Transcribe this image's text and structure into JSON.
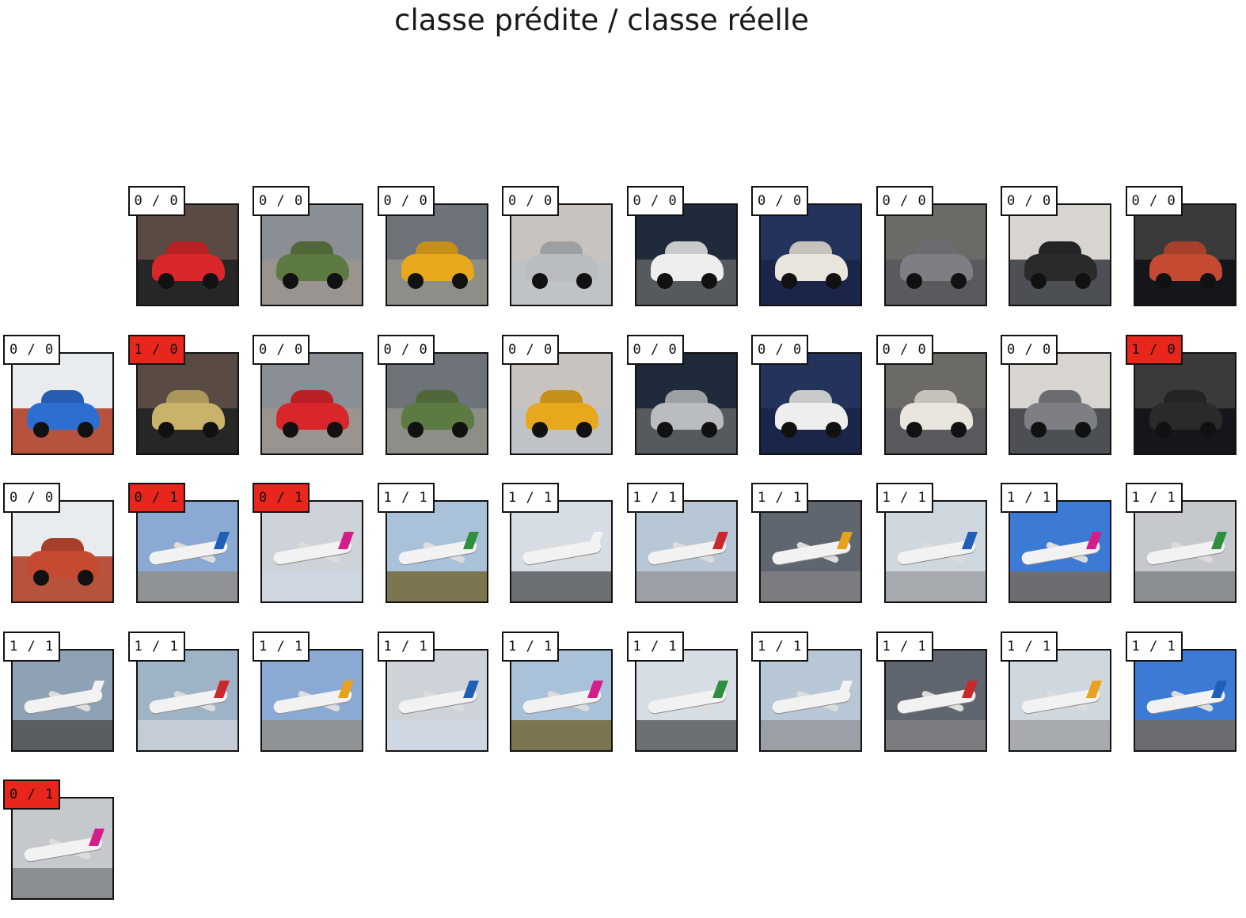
{
  "title": "classe prédite / classe réelle",
  "colors": {
    "misclassified": "#e8261c",
    "correct": "#ffffff"
  },
  "rows": [
    {
      "start_col": 1,
      "cells": [
        {
          "label": "0 / 0",
          "wrong": false,
          "kind": "car"
        },
        {
          "label": "0 / 0",
          "wrong": false,
          "kind": "car"
        },
        {
          "label": "0 / 0",
          "wrong": false,
          "kind": "car"
        },
        {
          "label": "0 / 0",
          "wrong": false,
          "kind": "car"
        },
        {
          "label": "0 / 0",
          "wrong": false,
          "kind": "car"
        },
        {
          "label": "0 / 0",
          "wrong": false,
          "kind": "car"
        },
        {
          "label": "0 / 0",
          "wrong": false,
          "kind": "car"
        },
        {
          "label": "0 / 0",
          "wrong": false,
          "kind": "car"
        },
        {
          "label": "0 / 0",
          "wrong": false,
          "kind": "car"
        }
      ]
    },
    {
      "start_col": 0,
      "cells": [
        {
          "label": "0 / 0",
          "wrong": false,
          "kind": "car"
        },
        {
          "label": "1 / 0",
          "wrong": true,
          "kind": "car"
        },
        {
          "label": "0 / 0",
          "wrong": false,
          "kind": "car"
        },
        {
          "label": "0 / 0",
          "wrong": false,
          "kind": "car"
        },
        {
          "label": "0 / 0",
          "wrong": false,
          "kind": "car"
        },
        {
          "label": "0 / 0",
          "wrong": false,
          "kind": "car"
        },
        {
          "label": "0 / 0",
          "wrong": false,
          "kind": "car"
        },
        {
          "label": "0 / 0",
          "wrong": false,
          "kind": "car"
        },
        {
          "label": "0 / 0",
          "wrong": false,
          "kind": "car"
        },
        {
          "label": "1 / 0",
          "wrong": true,
          "kind": "car"
        }
      ]
    },
    {
      "start_col": 0,
      "cells": [
        {
          "label": "0 / 0",
          "wrong": false,
          "kind": "car"
        },
        {
          "label": "0 / 1",
          "wrong": true,
          "kind": "plane"
        },
        {
          "label": "0 / 1",
          "wrong": true,
          "kind": "plane"
        },
        {
          "label": "1 / 1",
          "wrong": false,
          "kind": "plane"
        },
        {
          "label": "1 / 1",
          "wrong": false,
          "kind": "plane"
        },
        {
          "label": "1 / 1",
          "wrong": false,
          "kind": "plane"
        },
        {
          "label": "1 / 1",
          "wrong": false,
          "kind": "plane"
        },
        {
          "label": "1 / 1",
          "wrong": false,
          "kind": "plane"
        },
        {
          "label": "1 / 1",
          "wrong": false,
          "kind": "plane"
        },
        {
          "label": "1 / 1",
          "wrong": false,
          "kind": "plane"
        }
      ]
    },
    {
      "start_col": 0,
      "cells": [
        {
          "label": "1 / 1",
          "wrong": false,
          "kind": "plane"
        },
        {
          "label": "1 / 1",
          "wrong": false,
          "kind": "plane"
        },
        {
          "label": "1 / 1",
          "wrong": false,
          "kind": "plane"
        },
        {
          "label": "1 / 1",
          "wrong": false,
          "kind": "plane"
        },
        {
          "label": "1 / 1",
          "wrong": false,
          "kind": "plane"
        },
        {
          "label": "1 / 1",
          "wrong": false,
          "kind": "plane"
        },
        {
          "label": "1 / 1",
          "wrong": false,
          "kind": "plane"
        },
        {
          "label": "1 / 1",
          "wrong": false,
          "kind": "plane"
        },
        {
          "label": "1 / 1",
          "wrong": false,
          "kind": "plane"
        },
        {
          "label": "1 / 1",
          "wrong": false,
          "kind": "plane"
        }
      ]
    },
    {
      "start_col": 0,
      "cells": [
        {
          "label": "0 / 1",
          "wrong": true,
          "kind": "plane"
        }
      ]
    }
  ]
}
